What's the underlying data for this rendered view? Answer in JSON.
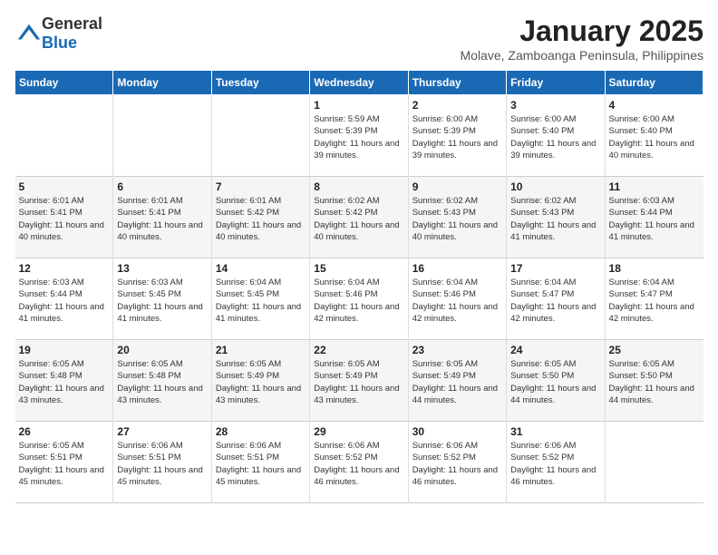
{
  "header": {
    "logo": {
      "general": "General",
      "blue": "Blue"
    },
    "title": "January 2025",
    "subtitle": "Molave, Zamboanga Peninsula, Philippines"
  },
  "weekdays": [
    "Sunday",
    "Monday",
    "Tuesday",
    "Wednesday",
    "Thursday",
    "Friday",
    "Saturday"
  ],
  "weeks": [
    [
      {
        "day": "",
        "sunrise": "",
        "sunset": "",
        "daylight": ""
      },
      {
        "day": "",
        "sunrise": "",
        "sunset": "",
        "daylight": ""
      },
      {
        "day": "",
        "sunrise": "",
        "sunset": "",
        "daylight": ""
      },
      {
        "day": "1",
        "sunrise": "Sunrise: 5:59 AM",
        "sunset": "Sunset: 5:39 PM",
        "daylight": "Daylight: 11 hours and 39 minutes."
      },
      {
        "day": "2",
        "sunrise": "Sunrise: 6:00 AM",
        "sunset": "Sunset: 5:39 PM",
        "daylight": "Daylight: 11 hours and 39 minutes."
      },
      {
        "day": "3",
        "sunrise": "Sunrise: 6:00 AM",
        "sunset": "Sunset: 5:40 PM",
        "daylight": "Daylight: 11 hours and 39 minutes."
      },
      {
        "day": "4",
        "sunrise": "Sunrise: 6:00 AM",
        "sunset": "Sunset: 5:40 PM",
        "daylight": "Daylight: 11 hours and 40 minutes."
      }
    ],
    [
      {
        "day": "5",
        "sunrise": "Sunrise: 6:01 AM",
        "sunset": "Sunset: 5:41 PM",
        "daylight": "Daylight: 11 hours and 40 minutes."
      },
      {
        "day": "6",
        "sunrise": "Sunrise: 6:01 AM",
        "sunset": "Sunset: 5:41 PM",
        "daylight": "Daylight: 11 hours and 40 minutes."
      },
      {
        "day": "7",
        "sunrise": "Sunrise: 6:01 AM",
        "sunset": "Sunset: 5:42 PM",
        "daylight": "Daylight: 11 hours and 40 minutes."
      },
      {
        "day": "8",
        "sunrise": "Sunrise: 6:02 AM",
        "sunset": "Sunset: 5:42 PM",
        "daylight": "Daylight: 11 hours and 40 minutes."
      },
      {
        "day": "9",
        "sunrise": "Sunrise: 6:02 AM",
        "sunset": "Sunset: 5:43 PM",
        "daylight": "Daylight: 11 hours and 40 minutes."
      },
      {
        "day": "10",
        "sunrise": "Sunrise: 6:02 AM",
        "sunset": "Sunset: 5:43 PM",
        "daylight": "Daylight: 11 hours and 41 minutes."
      },
      {
        "day": "11",
        "sunrise": "Sunrise: 6:03 AM",
        "sunset": "Sunset: 5:44 PM",
        "daylight": "Daylight: 11 hours and 41 minutes."
      }
    ],
    [
      {
        "day": "12",
        "sunrise": "Sunrise: 6:03 AM",
        "sunset": "Sunset: 5:44 PM",
        "daylight": "Daylight: 11 hours and 41 minutes."
      },
      {
        "day": "13",
        "sunrise": "Sunrise: 6:03 AM",
        "sunset": "Sunset: 5:45 PM",
        "daylight": "Daylight: 11 hours and 41 minutes."
      },
      {
        "day": "14",
        "sunrise": "Sunrise: 6:04 AM",
        "sunset": "Sunset: 5:45 PM",
        "daylight": "Daylight: 11 hours and 41 minutes."
      },
      {
        "day": "15",
        "sunrise": "Sunrise: 6:04 AM",
        "sunset": "Sunset: 5:46 PM",
        "daylight": "Daylight: 11 hours and 42 minutes."
      },
      {
        "day": "16",
        "sunrise": "Sunrise: 6:04 AM",
        "sunset": "Sunset: 5:46 PM",
        "daylight": "Daylight: 11 hours and 42 minutes."
      },
      {
        "day": "17",
        "sunrise": "Sunrise: 6:04 AM",
        "sunset": "Sunset: 5:47 PM",
        "daylight": "Daylight: 11 hours and 42 minutes."
      },
      {
        "day": "18",
        "sunrise": "Sunrise: 6:04 AM",
        "sunset": "Sunset: 5:47 PM",
        "daylight": "Daylight: 11 hours and 42 minutes."
      }
    ],
    [
      {
        "day": "19",
        "sunrise": "Sunrise: 6:05 AM",
        "sunset": "Sunset: 5:48 PM",
        "daylight": "Daylight: 11 hours and 43 minutes."
      },
      {
        "day": "20",
        "sunrise": "Sunrise: 6:05 AM",
        "sunset": "Sunset: 5:48 PM",
        "daylight": "Daylight: 11 hours and 43 minutes."
      },
      {
        "day": "21",
        "sunrise": "Sunrise: 6:05 AM",
        "sunset": "Sunset: 5:49 PM",
        "daylight": "Daylight: 11 hours and 43 minutes."
      },
      {
        "day": "22",
        "sunrise": "Sunrise: 6:05 AM",
        "sunset": "Sunset: 5:49 PM",
        "daylight": "Daylight: 11 hours and 43 minutes."
      },
      {
        "day": "23",
        "sunrise": "Sunrise: 6:05 AM",
        "sunset": "Sunset: 5:49 PM",
        "daylight": "Daylight: 11 hours and 44 minutes."
      },
      {
        "day": "24",
        "sunrise": "Sunrise: 6:05 AM",
        "sunset": "Sunset: 5:50 PM",
        "daylight": "Daylight: 11 hours and 44 minutes."
      },
      {
        "day": "25",
        "sunrise": "Sunrise: 6:05 AM",
        "sunset": "Sunset: 5:50 PM",
        "daylight": "Daylight: 11 hours and 44 minutes."
      }
    ],
    [
      {
        "day": "26",
        "sunrise": "Sunrise: 6:05 AM",
        "sunset": "Sunset: 5:51 PM",
        "daylight": "Daylight: 11 hours and 45 minutes."
      },
      {
        "day": "27",
        "sunrise": "Sunrise: 6:06 AM",
        "sunset": "Sunset: 5:51 PM",
        "daylight": "Daylight: 11 hours and 45 minutes."
      },
      {
        "day": "28",
        "sunrise": "Sunrise: 6:06 AM",
        "sunset": "Sunset: 5:51 PM",
        "daylight": "Daylight: 11 hours and 45 minutes."
      },
      {
        "day": "29",
        "sunrise": "Sunrise: 6:06 AM",
        "sunset": "Sunset: 5:52 PM",
        "daylight": "Daylight: 11 hours and 46 minutes."
      },
      {
        "day": "30",
        "sunrise": "Sunrise: 6:06 AM",
        "sunset": "Sunset: 5:52 PM",
        "daylight": "Daylight: 11 hours and 46 minutes."
      },
      {
        "day": "31",
        "sunrise": "Sunrise: 6:06 AM",
        "sunset": "Sunset: 5:52 PM",
        "daylight": "Daylight: 11 hours and 46 minutes."
      },
      {
        "day": "",
        "sunrise": "",
        "sunset": "",
        "daylight": ""
      }
    ]
  ]
}
